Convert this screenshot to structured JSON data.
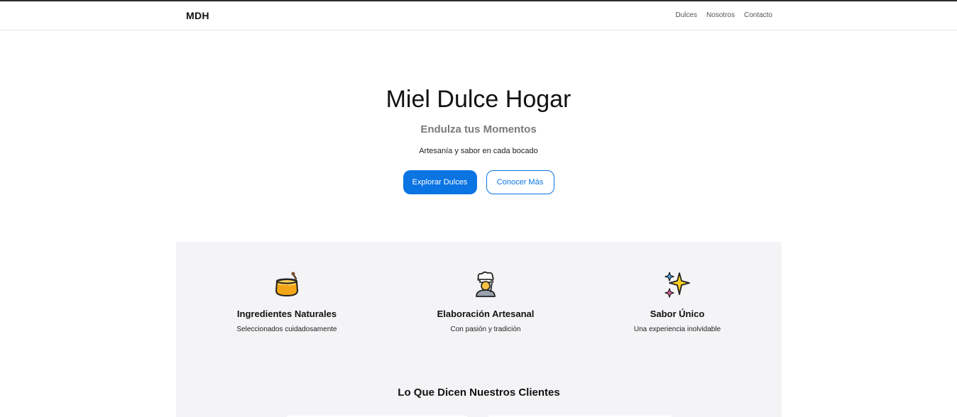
{
  "header": {
    "brand": "MDH",
    "nav": [
      "Dulces",
      "Nosotros",
      "Contacto"
    ]
  },
  "hero": {
    "title": "Miel Dulce Hogar",
    "subtitle": "Endulza tus Momentos",
    "tagline": "Artesanía y sabor en cada bocado",
    "primary_button": "Explorar Dulces",
    "secondary_button": "Conocer Más"
  },
  "features": [
    {
      "icon": "honey-pot-icon",
      "title": "Ingredientes Naturales",
      "description": "Seleccionados cuidadosamente"
    },
    {
      "icon": "chef-icon",
      "title": "Elaboración Artesanal",
      "description": "Con pasión y tradición"
    },
    {
      "icon": "sparkles-icon",
      "title": "Sabor Único",
      "description": "Una experiencia inolvidable"
    }
  ],
  "testimonials": {
    "title": "Lo Que Dicen Nuestros Clientes"
  },
  "colors": {
    "accent": "#0a74e3",
    "section_bg": "#f4f4f6",
    "subtitle": "#7a7a7a"
  }
}
